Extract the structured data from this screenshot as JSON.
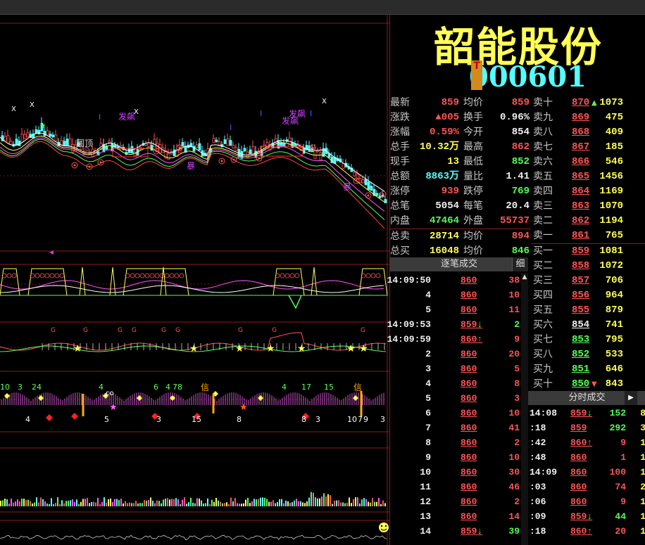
{
  "stock": {
    "name": "韶能股份",
    "code": "000601",
    "badge": "T"
  },
  "quote": [
    {
      "l1": "最新",
      "v1": "859",
      "c1": "red",
      "l2": "均价",
      "v2": "859",
      "c2": "red"
    },
    {
      "l1": "涨跌",
      "v1": "▲005",
      "c1": "red",
      "l2": "换手",
      "v2": "0.96%",
      "c2": "white"
    },
    {
      "l1": "涨幅",
      "v1": "0.59%",
      "c1": "red",
      "l2": "今开",
      "v2": "854",
      "c2": "white"
    },
    {
      "l1": "总手",
      "v1": "10.32万",
      "c1": "yellow",
      "l2": "最高",
      "v2": "862",
      "c2": "red"
    },
    {
      "l1": "现手",
      "v1": "13",
      "c1": "yellow",
      "l2": "最低",
      "v2": "852",
      "c2": "green"
    },
    {
      "l1": "总额",
      "v1": "8863万",
      "c1": "cyan",
      "l2": "量比",
      "v2": "1.41",
      "c2": "white"
    },
    {
      "l1": "涨停",
      "v1": "939",
      "c1": "red",
      "l2": "跌停",
      "v2": "769",
      "c2": "green"
    },
    {
      "l1": "总笔",
      "v1": "5054",
      "c1": "white",
      "l2": "每笔",
      "v2": "20.4",
      "c2": "white"
    },
    {
      "l1": "内盘",
      "v1": "47464",
      "c1": "green",
      "l2": "外盘",
      "v2": "55737",
      "c2": "red"
    },
    {
      "l1": "总卖",
      "v1": "28714",
      "c1": "yellow",
      "l2": "均价",
      "v2": "894",
      "c2": "red"
    },
    {
      "l1": "总买",
      "v1": "16048",
      "c1": "yellow",
      "l2": "均价",
      "v2": "846",
      "c2": "green"
    }
  ],
  "book": [
    {
      "label": "卖十",
      "price": "870",
      "pc": "red",
      "vol": "1073",
      "mark": "▲"
    },
    {
      "label": "卖九",
      "price": "869",
      "pc": "red",
      "vol": "475",
      "mark": ""
    },
    {
      "label": "卖八",
      "price": "868",
      "pc": "red",
      "vol": "409",
      "mark": ""
    },
    {
      "label": "卖七",
      "price": "867",
      "pc": "red",
      "vol": "185",
      "mark": ""
    },
    {
      "label": "卖六",
      "price": "866",
      "pc": "red",
      "vol": "546",
      "mark": ""
    },
    {
      "label": "卖五",
      "price": "865",
      "pc": "red",
      "vol": "1456",
      "mark": ""
    },
    {
      "label": "卖四",
      "price": "864",
      "pc": "red",
      "vol": "1169",
      "mark": ""
    },
    {
      "label": "卖三",
      "price": "863",
      "pc": "red",
      "vol": "1070",
      "mark": ""
    },
    {
      "label": "卖二",
      "price": "862",
      "pc": "red",
      "vol": "1194",
      "mark": ""
    },
    {
      "label": "卖一",
      "price": "861",
      "pc": "red",
      "vol": "765",
      "mark": ""
    },
    {
      "label": "买一",
      "price": "859",
      "pc": "red",
      "vol": "1081",
      "mark": ""
    },
    {
      "label": "买二",
      "price": "858",
      "pc": "red",
      "vol": "1072",
      "mark": ""
    },
    {
      "label": "买三",
      "price": "857",
      "pc": "red",
      "vol": "706",
      "mark": ""
    },
    {
      "label": "买四",
      "price": "856",
      "pc": "red",
      "vol": "964",
      "mark": ""
    },
    {
      "label": "买五",
      "price": "855",
      "pc": "red",
      "vol": "879",
      "mark": ""
    },
    {
      "label": "买六",
      "price": "854",
      "pc": "white",
      "vol": "741",
      "mark": ""
    },
    {
      "label": "买七",
      "price": "853",
      "pc": "green",
      "vol": "795",
      "mark": ""
    },
    {
      "label": "买八",
      "price": "852",
      "pc": "green",
      "vol": "533",
      "mark": ""
    },
    {
      "label": "买九",
      "price": "851",
      "pc": "green",
      "vol": "646",
      "mark": ""
    },
    {
      "label": "买十",
      "price": "850",
      "pc": "green",
      "vol": "843",
      "mark": "▼"
    }
  ],
  "ticks_title": "逐笔成交",
  "ticks_fine": "细",
  "ticks": [
    {
      "time": "14:09:50",
      "price": "860",
      "pc": "red",
      "arrow": "",
      "vol": "38",
      "vc": "red"
    },
    {
      "time": "4",
      "price": "860",
      "pc": "red",
      "arrow": "",
      "vol": "10",
      "vc": "red"
    },
    {
      "time": "5",
      "price": "860",
      "pc": "red",
      "arrow": "",
      "vol": "11",
      "vc": "red"
    },
    {
      "time": "14:09:53",
      "price": "859",
      "pc": "red",
      "arrow": "↓",
      "vol": "2",
      "vc": "green"
    },
    {
      "time": "14:09:59",
      "price": "860",
      "pc": "red",
      "arrow": "↑",
      "vol": "9",
      "vc": "red"
    },
    {
      "time": "2",
      "price": "860",
      "pc": "red",
      "arrow": "",
      "vol": "20",
      "vc": "red"
    },
    {
      "time": "3",
      "price": "860",
      "pc": "red",
      "arrow": "",
      "vol": "5",
      "vc": "red"
    },
    {
      "time": "4",
      "price": "860",
      "pc": "red",
      "arrow": "",
      "vol": "8",
      "vc": "red"
    },
    {
      "time": "5",
      "price": "860",
      "pc": "red",
      "arrow": "",
      "vol": "3",
      "vc": "red"
    },
    {
      "time": "6",
      "price": "860",
      "pc": "red",
      "arrow": "",
      "vol": "10",
      "vc": "red"
    },
    {
      "time": "7",
      "price": "860",
      "pc": "red",
      "arrow": "",
      "vol": "41",
      "vc": "red"
    },
    {
      "time": "8",
      "price": "860",
      "pc": "red",
      "arrow": "",
      "vol": "2",
      "vc": "red"
    },
    {
      "time": "9",
      "price": "860",
      "pc": "red",
      "arrow": "",
      "vol": "10",
      "vc": "red"
    },
    {
      "time": "10",
      "price": "860",
      "pc": "red",
      "arrow": "",
      "vol": "30",
      "vc": "red"
    },
    {
      "time": "11",
      "price": "860",
      "pc": "red",
      "arrow": "",
      "vol": "46",
      "vc": "red"
    },
    {
      "time": "12",
      "price": "860",
      "pc": "red",
      "arrow": "",
      "vol": "2",
      "vc": "red"
    },
    {
      "time": "13",
      "price": "860",
      "pc": "red",
      "arrow": "",
      "vol": "14",
      "vc": "red"
    },
    {
      "time": "14",
      "price": "859",
      "pc": "red",
      "arrow": "↓",
      "vol": "39",
      "vc": "green"
    }
  ],
  "minute_title": "分时成交",
  "minutes": [
    {
      "time": "14:08",
      "price": "859",
      "pc": "red",
      "arrow": "↓",
      "vol": "152",
      "vc": "green",
      "extra": "8"
    },
    {
      "time": ":18",
      "price": "859",
      "pc": "red",
      "arrow": "",
      "vol": "292",
      "vc": "green",
      "extra": "3"
    },
    {
      "time": ":42",
      "price": "860",
      "pc": "red",
      "arrow": "↑",
      "vol": "9",
      "vc": "red",
      "extra": "1"
    },
    {
      "time": ":48",
      "price": "860",
      "pc": "red",
      "arrow": "",
      "vol": "1",
      "vc": "red",
      "extra": "1"
    },
    {
      "time": "14:09",
      "price": "860",
      "pc": "red",
      "arrow": "",
      "vol": "100",
      "vc": "red",
      "extra": "1"
    },
    {
      "time": ":03",
      "price": "860",
      "pc": "red",
      "arrow": "",
      "vol": "74",
      "vc": "red",
      "extra": "2"
    },
    {
      "time": ":06",
      "price": "860",
      "pc": "red",
      "arrow": "",
      "vol": "9",
      "vc": "red",
      "extra": "1"
    },
    {
      "time": ":09",
      "price": "859",
      "pc": "red",
      "arrow": "↓",
      "vol": "44",
      "vc": "green",
      "extra": "1"
    },
    {
      "time": ":18",
      "price": "860",
      "pc": "red",
      "arrow": "↑",
      "vol": "20",
      "vc": "red",
      "extra": "1"
    }
  ],
  "chart_labels": {
    "fa_piao": "发飙",
    "yuan_ding": "圆顶",
    "bao": "暴",
    "xin": "信",
    "star": "★",
    "x_mark": "X",
    "g_mark": "G",
    "i_mark": "I",
    "co_mark": "co",
    "seq_bottom": [
      "4",
      "5",
      "3",
      "15",
      "8",
      "8",
      "3",
      "10",
      "7",
      "9",
      "3"
    ],
    "seq_top": [
      "10",
      "3",
      "24",
      "4",
      "6",
      "4",
      "78",
      "4",
      "17",
      "15"
    ]
  },
  "colors": {
    "up": "#ff5555",
    "down": "#55ff55",
    "accent": "#ffff55",
    "frame": "#8b1a1a"
  }
}
